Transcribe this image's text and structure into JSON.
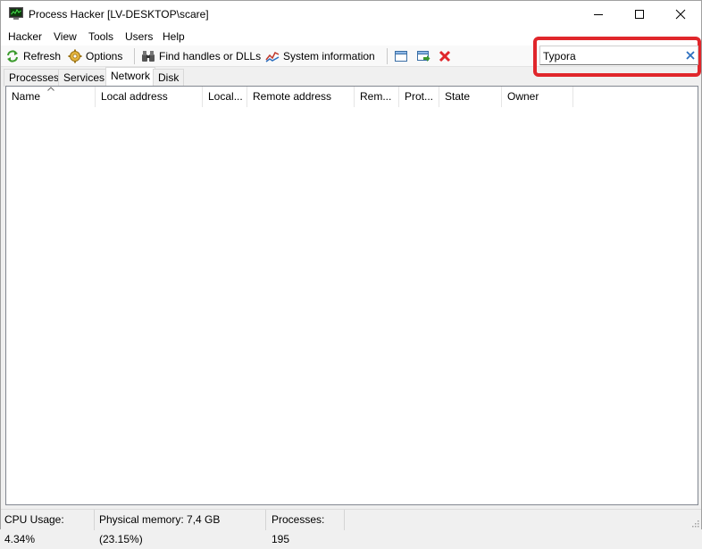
{
  "window": {
    "title": "Process Hacker [LV-DESKTOP\\scare]",
    "icon": "process-hacker-app-icon"
  },
  "menu": {
    "items": [
      "Hacker",
      "View",
      "Tools",
      "Users",
      "Help"
    ]
  },
  "toolbar": {
    "refresh_label": "Refresh",
    "options_label": "Options",
    "find_handles_label": "Find handles or DLLs",
    "system_info_label": "System information"
  },
  "search": {
    "value": "Typora",
    "highlight_color": "#e0262b"
  },
  "tabs": [
    "Processes",
    "Services",
    "Network",
    "Disk"
  ],
  "active_tab": "Network",
  "columns": [
    "Name",
    "Local address",
    "Local...",
    "Remote address",
    "Rem...",
    "Prot...",
    "State",
    "Owner"
  ],
  "status": {
    "cpu": "CPU Usage: 4.34%",
    "memory": "Physical memory: 7,4 GB (23.15%)",
    "processes": "Processes: 195"
  }
}
